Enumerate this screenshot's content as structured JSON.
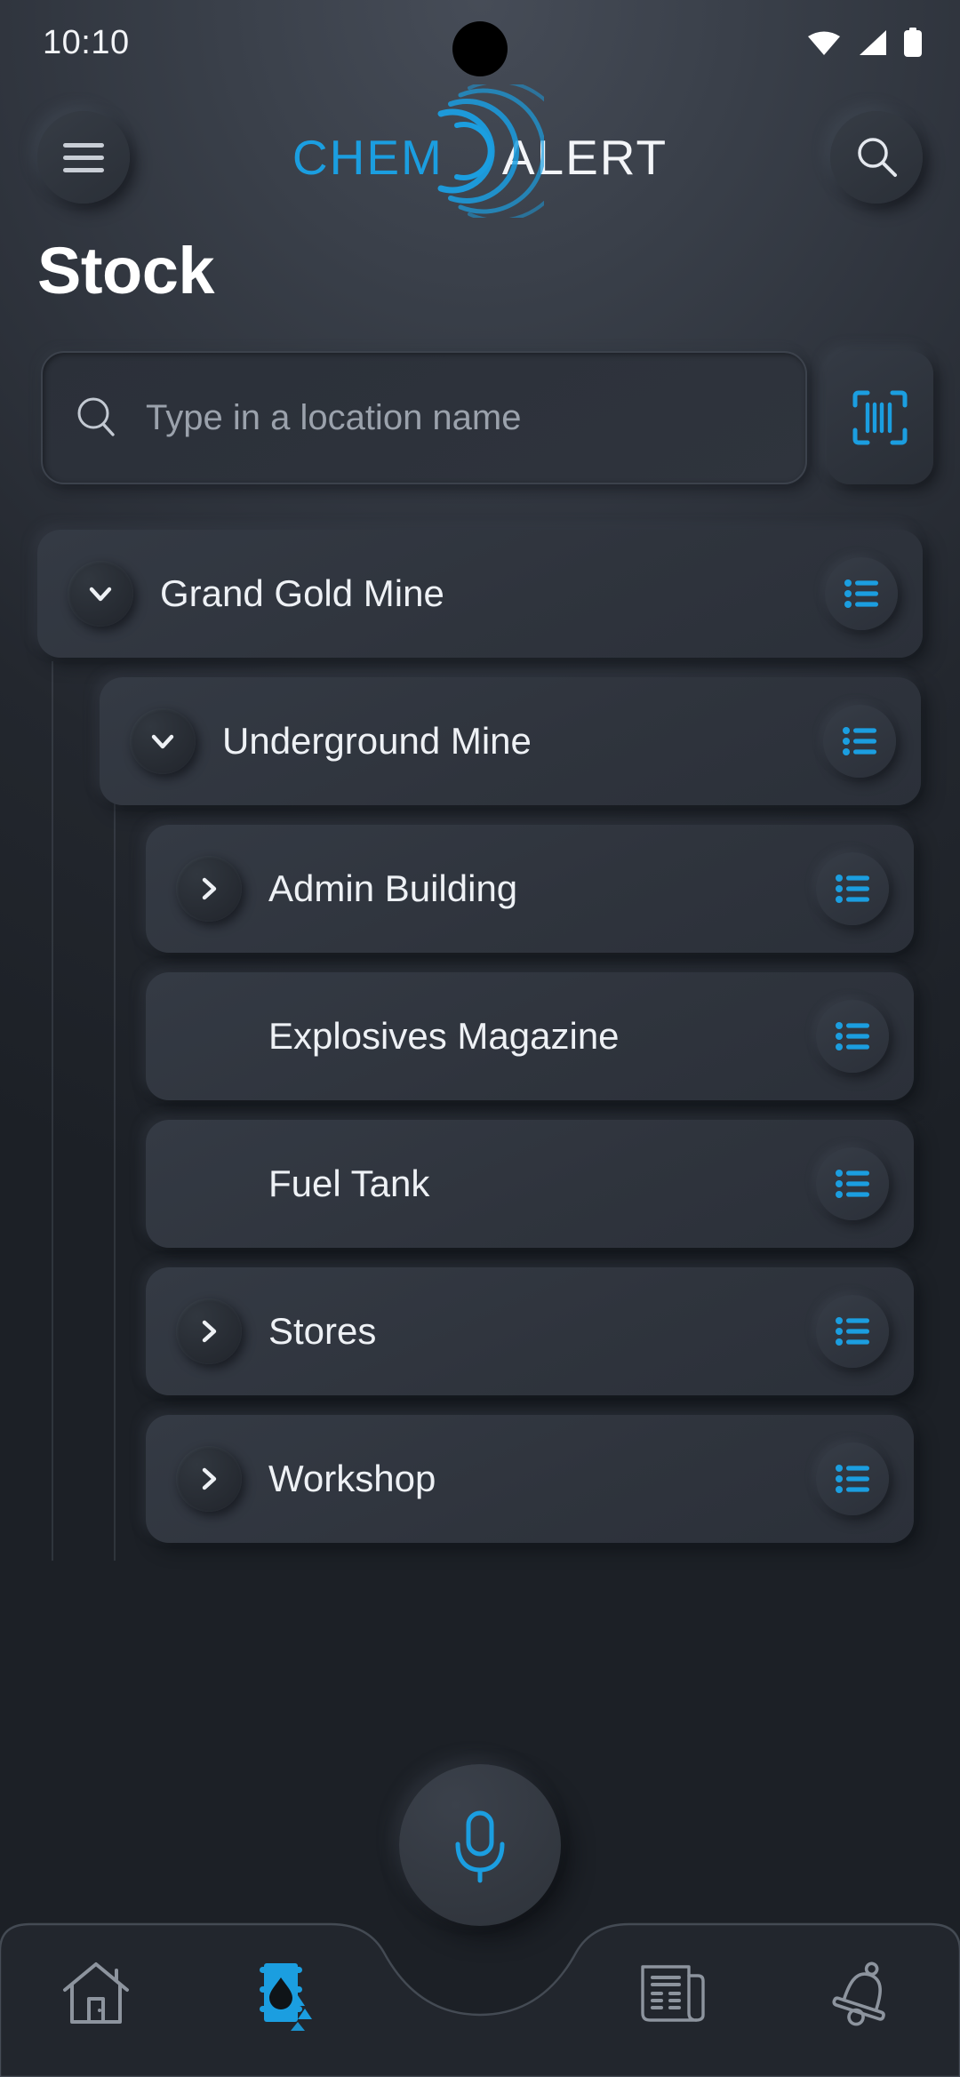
{
  "status_bar": {
    "time": "10:10",
    "icons": [
      "wifi-icon",
      "cellular-signal-icon",
      "battery-icon"
    ]
  },
  "header": {
    "menu_button": "menu-button",
    "search_button": "search-button",
    "logo": {
      "part1": "CHEM",
      "part2": "ALERT",
      "part1_color": "#1b9ee0",
      "part2_color": "#f3f5f8"
    }
  },
  "page": {
    "title": "Stock"
  },
  "search": {
    "placeholder": "Type in a location name",
    "value": "",
    "scan_button_label": "barcode-scan-icon"
  },
  "theme": {
    "accent": "#1b9ee0",
    "background": "#2e333c",
    "card": "#31363f",
    "text": "#eef1f5",
    "muted": "#9ba2ac"
  },
  "tree": {
    "nodes": [
      {
        "label": "Grand Gold Mine",
        "level": 0,
        "expandable": true,
        "expanded": true,
        "action": "list-icon"
      },
      {
        "label": "Underground Mine",
        "level": 1,
        "expandable": true,
        "expanded": true,
        "action": "list-icon"
      },
      {
        "label": "Admin Building",
        "level": 2,
        "expandable": true,
        "expanded": false,
        "action": "list-icon"
      },
      {
        "label": "Explosives Magazine",
        "level": 2,
        "expandable": false,
        "expanded": false,
        "action": "list-icon"
      },
      {
        "label": "Fuel Tank",
        "level": 2,
        "expandable": false,
        "expanded": false,
        "action": "list-icon"
      },
      {
        "label": "Stores",
        "level": 2,
        "expandable": true,
        "expanded": false,
        "action": "list-icon"
      },
      {
        "label": "Workshop",
        "level": 2,
        "expandable": true,
        "expanded": false,
        "action": "list-icon"
      }
    ]
  },
  "bottom_nav": {
    "items": [
      {
        "icon": "home-icon",
        "name": "nav-home",
        "active": false
      },
      {
        "icon": "chemical-drum-icon",
        "name": "nav-stock",
        "active": true
      },
      {
        "icon": "newspaper-icon",
        "name": "nav-documents",
        "active": false
      },
      {
        "icon": "bell-icon",
        "name": "nav-notifications",
        "active": false
      }
    ],
    "fab": {
      "icon": "microphone-icon",
      "name": "voice-assistant-button"
    }
  }
}
